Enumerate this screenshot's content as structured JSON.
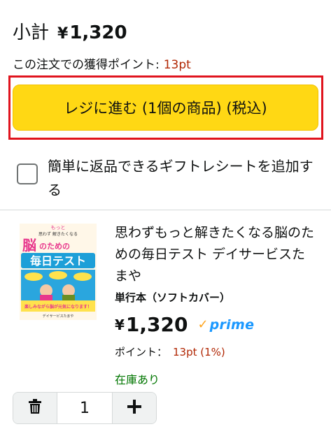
{
  "cart": {
    "subtotal_label": "小計",
    "subtotal_currency": "¥",
    "subtotal_amount": "1,320",
    "points_label": "この注文での獲得ポイント:",
    "points_value": "13pt",
    "checkout_button": "レジに進む (1個の商品) (税込)",
    "gift_receipt_label": "簡単に返品できるギフトレシートを追加する",
    "gift_receipt_checked": false
  },
  "item": {
    "title": "思わずもっと解きたくなる脳のための毎日テスト デイサービスたまや",
    "binding": "単行本（ソフトカバー）",
    "price_currency": "¥",
    "price_amount": "1,320",
    "prime_check": "✓",
    "prime_label": "prime",
    "points_label": "ポイント：",
    "points_value": "13pt (1%)",
    "availability": "在庫あり",
    "quantity": "1",
    "cover": {
      "top_small": "もっと",
      "top_line": "思わず 解きたくなる",
      "brain": "脳",
      "for": "のための",
      "main": "毎日テスト",
      "bottom_line": "楽しみながら脳が元気になります！",
      "author": "デイサービスたまや"
    }
  },
  "icons": {
    "delete": "trash-icon",
    "increase": "plus-icon"
  },
  "colors": {
    "checkout_button": "#ffd814",
    "highlight_frame": "#e0141e",
    "points": "#b12704",
    "in_stock": "#007600",
    "prime_blue": "#1a98ff",
    "prime_check": "#ffa41c"
  }
}
